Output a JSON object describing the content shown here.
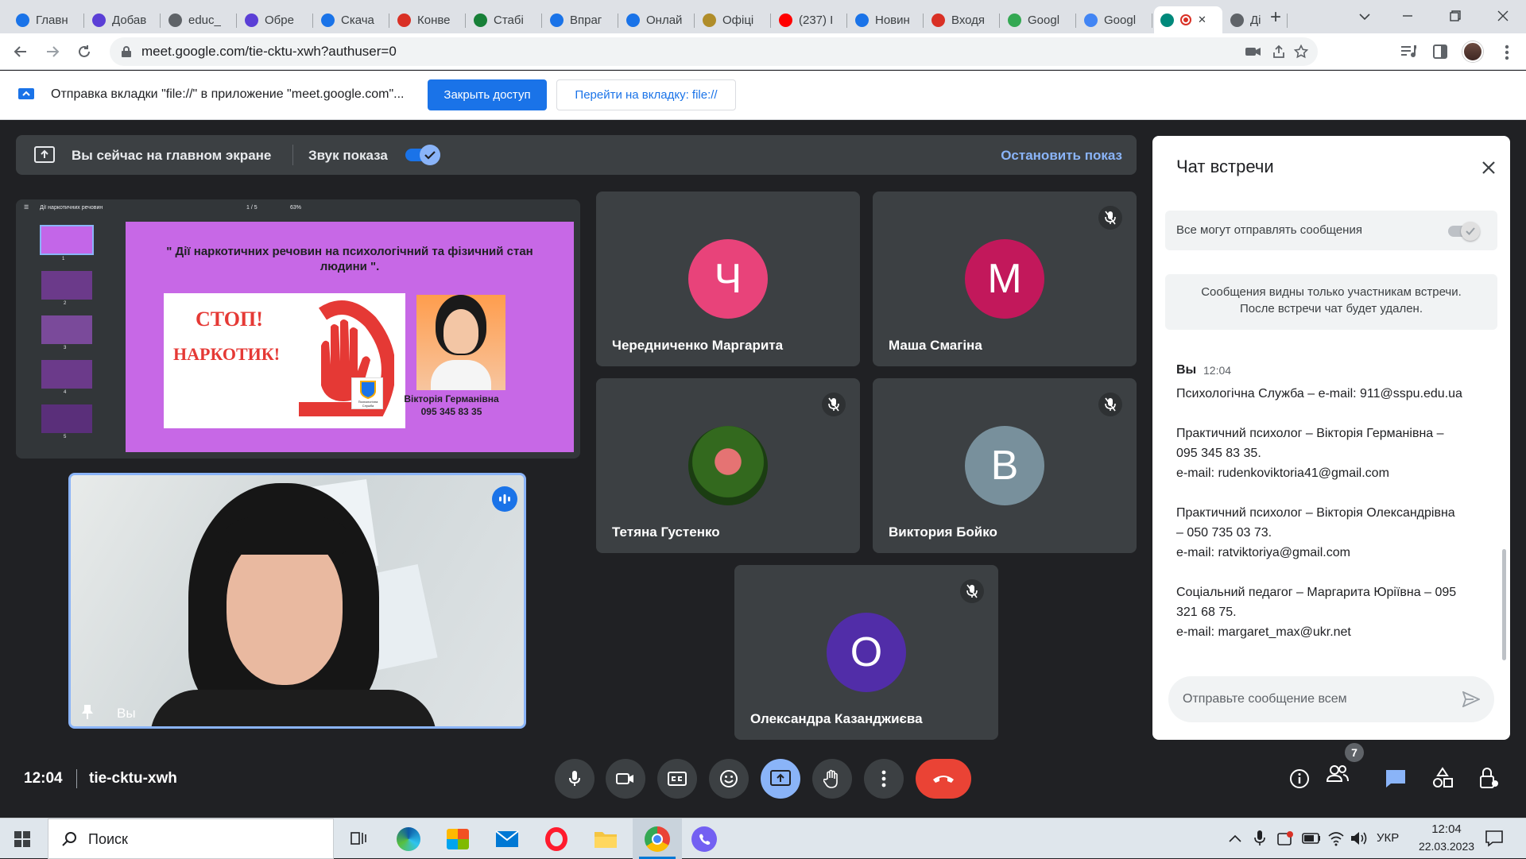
{
  "browser": {
    "tabs": [
      {
        "label": "Главн",
        "color": "#1a73e8"
      },
      {
        "label": "Добав",
        "color": "#5b3fd6"
      },
      {
        "label": "educ_",
        "color": "#5f6368"
      },
      {
        "label": "Обре",
        "color": "#5b3fd6"
      },
      {
        "label": "Скача",
        "color": "#1a73e8"
      },
      {
        "label": "Конве",
        "color": "#d93025"
      },
      {
        "label": "Стабі",
        "color": "#188038"
      },
      {
        "label": "Впраг",
        "color": "#1a73e8"
      },
      {
        "label": "Онлай",
        "color": "#1a73e8"
      },
      {
        "label": "Офіці",
        "color": "#b08d2a"
      },
      {
        "label": "(237) I",
        "color": "#ff0000"
      },
      {
        "label": "Новин",
        "color": "#1a73e8"
      },
      {
        "label": "Входя",
        "color": "#d93025"
      },
      {
        "label": "Googl",
        "color": "#34a853"
      },
      {
        "label": "Googl",
        "color": "#4285f4"
      },
      {
        "label": "",
        "color": "#00897b"
      },
      {
        "label": "Ді",
        "color": "#5f6368"
      }
    ],
    "url": "meet.google.com/tie-cktu-xwh?authuser=0",
    "infobar": {
      "message": "Отправка вкладки \"file://\" в приложение \"meet.google.com\"...",
      "stop_button": "Закрыть доступ",
      "switch_button": "Перейти на вкладку: file://"
    }
  },
  "meet": {
    "share_bar": {
      "status": "Вы сейчас на главном экране",
      "audio_label": "Звук показа",
      "audio_on": true,
      "stop_label": "Остановить показ"
    },
    "presentation": {
      "doc_title": "Дії наркотичних речовин",
      "page": "1 / 5",
      "zoom": "63%",
      "slide_title": "\" Дії наркотичних речовин на психологічний та фізичний стан людини \".",
      "stop_text_1": "СТОП!",
      "stop_text_2": "НАРКОТИК!",
      "person_name": "Вікторія Германівна",
      "person_phone": "095 345 83 35",
      "logo_text": "Психологічна Служба",
      "thumb_numbers": [
        "1",
        "2",
        "3",
        "4",
        "5"
      ]
    },
    "self_tile": {
      "label": "Вы"
    },
    "participants": [
      {
        "name": "Чередниченко Маргарита",
        "initial": "Ч",
        "color": "#e8437a",
        "muted": false
      },
      {
        "name": "Маша Смагіна",
        "initial": "М",
        "color": "#c2185b",
        "muted": true
      },
      {
        "name": "Тетяна Густенко",
        "initial": "",
        "color": "#4a6b2a",
        "muted": true
      },
      {
        "name": "Виктория Бойко",
        "initial": "В",
        "color": "#78909c",
        "muted": true
      },
      {
        "name": "Олександра Казанджиєва",
        "initial": "О",
        "color": "#512da8",
        "muted": true
      }
    ],
    "meeting_time": "12:04",
    "meeting_code": "tie-cktu-xwh",
    "participant_count": "7",
    "chat": {
      "title": "Чат встречи",
      "toggle_label": "Все могут отправлять сообщения",
      "notice": "Сообщения видны только участникам встречи. После встречи чат будет удален.",
      "sender": "Вы",
      "time": "12:04",
      "lines": [
        "Психологічна Служба – e-mail: 911@sspu.edu.ua",
        "",
        "Практичний психолог – Вікторія Германівна –",
        "095 345 83 35.",
        "e-mail: rudenkoviktoria41@gmail.com",
        "",
        "Практичний психолог – Вікторія Олександрівна",
        "– 050 735 03 73.",
        "e-mail: ratviktoriya@gmail.com",
        "",
        "Соціальний педагог – Маргарита Юріївна – 095",
        "321 68 75.",
        "e-mail: margaret_max@ukr.net"
      ],
      "input_placeholder": "Отправьте сообщение всем"
    }
  },
  "taskbar": {
    "search_label": "Поиск",
    "lang": "УКР",
    "time": "12:04",
    "date": "22.03.2023"
  }
}
